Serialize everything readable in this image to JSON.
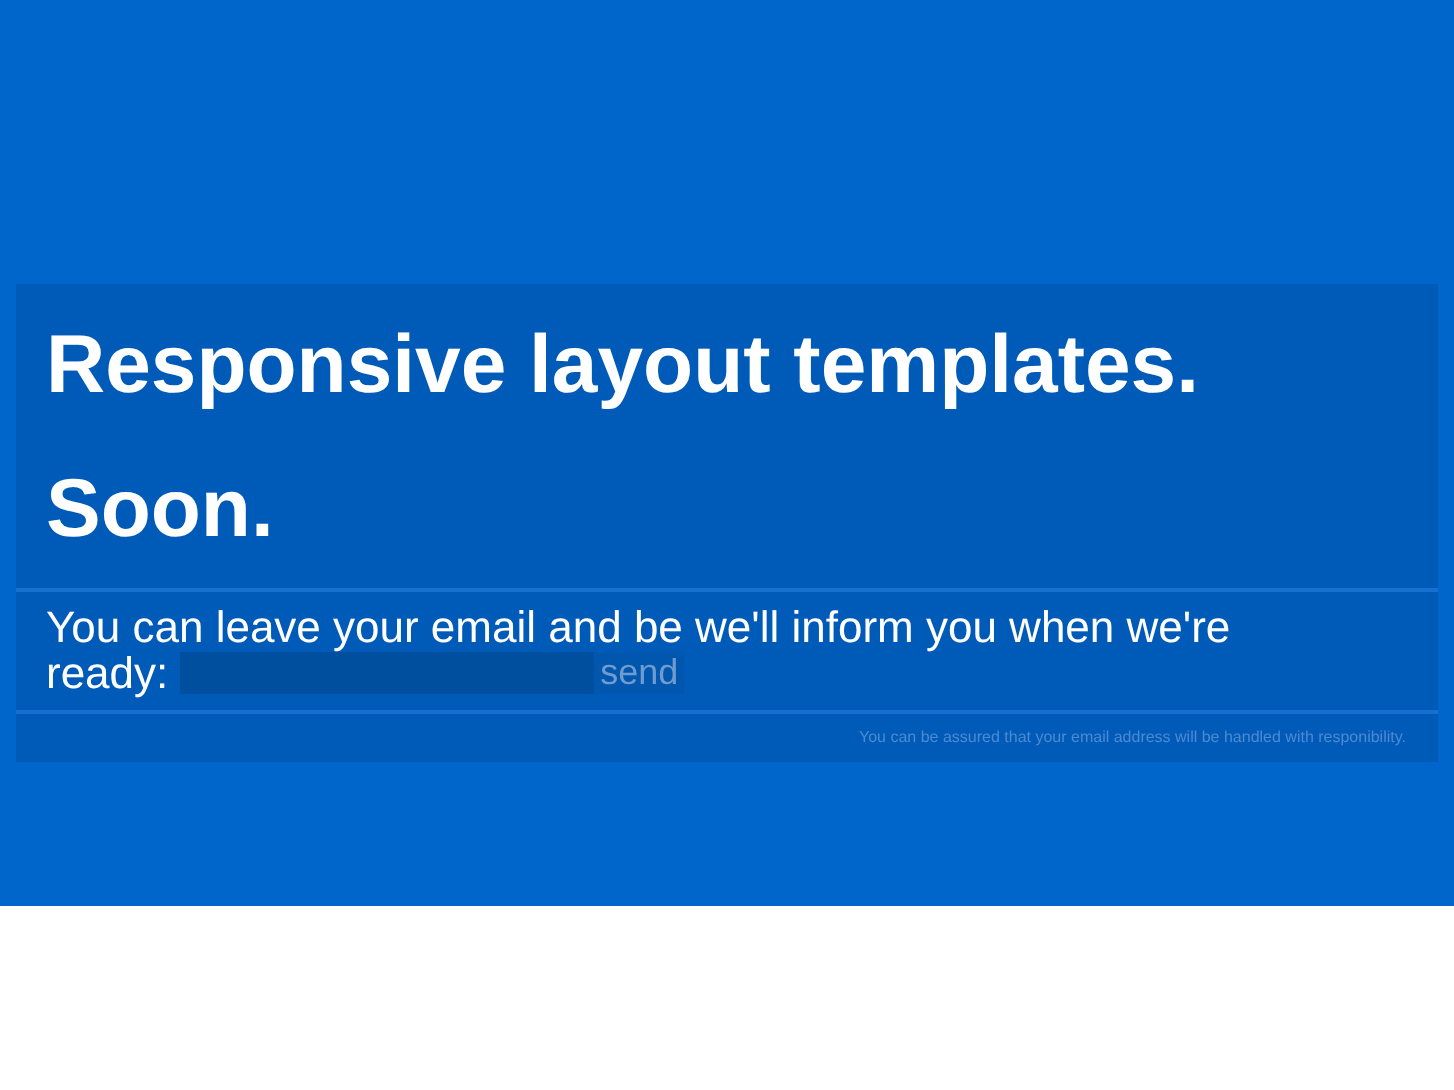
{
  "heading": "Responsive layout templates. Soon.",
  "signup": {
    "text_lines": [
      "You can leave your email and be we'll inform you when we're",
      "ready:"
    ],
    "button": "send"
  },
  "note": "You can be assured that your email address will be handled with responibility."
}
